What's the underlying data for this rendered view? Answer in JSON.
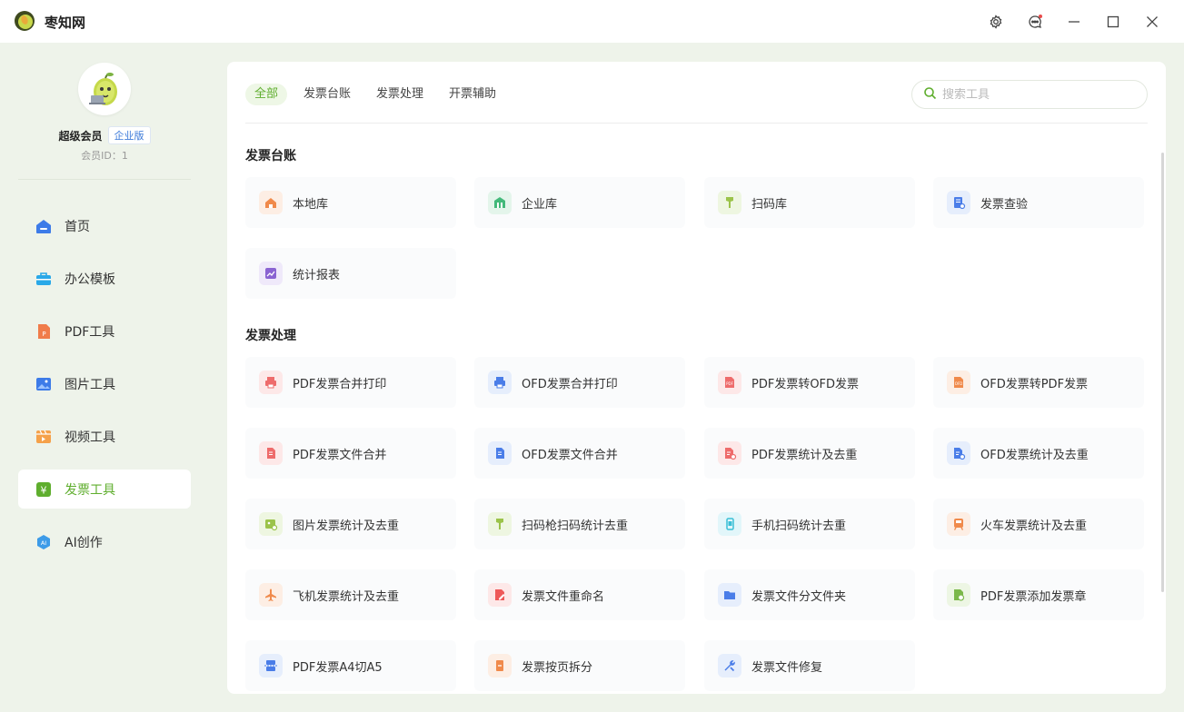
{
  "app": {
    "name": "枣知网"
  },
  "sidebar": {
    "member_title": "超级会员",
    "member_badge": "企业版",
    "member_id": "会员ID：1",
    "items": [
      {
        "label": "首页",
        "icon": "home-icon",
        "active": false
      },
      {
        "label": "办公模板",
        "icon": "briefcase-icon",
        "active": false
      },
      {
        "label": "PDF工具",
        "icon": "pdf-icon",
        "active": false
      },
      {
        "label": "图片工具",
        "icon": "image-icon",
        "active": false
      },
      {
        "label": "视频工具",
        "icon": "video-icon",
        "active": false
      },
      {
        "label": "发票工具",
        "icon": "invoice-icon",
        "active": true
      },
      {
        "label": "AI创作",
        "icon": "ai-icon",
        "active": false
      }
    ]
  },
  "tabs": [
    {
      "label": "全部",
      "active": true
    },
    {
      "label": "发票台账",
      "active": false
    },
    {
      "label": "发票处理",
      "active": false
    },
    {
      "label": "开票辅助",
      "active": false
    }
  ],
  "search": {
    "placeholder": "搜索工具"
  },
  "sections": [
    {
      "title": "发票台账",
      "tools": [
        {
          "label": "本地库",
          "icon": "home-store-icon",
          "color": "#f08a4b",
          "bg": "#fdeee4"
        },
        {
          "label": "企业库",
          "icon": "building-icon",
          "color": "#43b97a",
          "bg": "#e4f5eb"
        },
        {
          "label": "扫码库",
          "icon": "scanner-icon",
          "color": "#9bc34a",
          "bg": "#eef6e1"
        },
        {
          "label": "发票查验",
          "icon": "invoice-check-icon",
          "color": "#4a7de8",
          "bg": "#e6eefc"
        },
        {
          "label": "统计报表",
          "icon": "report-chart-icon",
          "color": "#8a63d2",
          "bg": "#efe9fa"
        }
      ]
    },
    {
      "title": "发票处理",
      "tools": [
        {
          "label": "PDF发票合并打印",
          "icon": "printer-icon",
          "color": "#ee6b6b",
          "bg": "#fde8e8"
        },
        {
          "label": "OFD发票合并打印",
          "icon": "printer-icon",
          "color": "#4a7de8",
          "bg": "#e6eefc"
        },
        {
          "label": "PDF发票转OFD发票",
          "icon": "pdf-convert-icon",
          "color": "#ee6b6b",
          "bg": "#fde8e8"
        },
        {
          "label": "OFD发票转PDF发票",
          "icon": "ofd-convert-icon",
          "color": "#f08a4b",
          "bg": "#fdeee4"
        },
        {
          "label": "PDF发票文件合并",
          "icon": "file-merge-icon",
          "color": "#ee6b6b",
          "bg": "#fde8e8"
        },
        {
          "label": "OFD发票文件合并",
          "icon": "file-merge-icon",
          "color": "#4a7de8",
          "bg": "#e6eefc"
        },
        {
          "label": "PDF发票统计及去重",
          "icon": "file-dedupe-icon",
          "color": "#ee6b6b",
          "bg": "#fde8e8"
        },
        {
          "label": "OFD发票统计及去重",
          "icon": "file-dedupe-icon",
          "color": "#4a7de8",
          "bg": "#e6eefc"
        },
        {
          "label": "图片发票统计及去重",
          "icon": "image-dedupe-icon",
          "color": "#9bc34a",
          "bg": "#eef6e1"
        },
        {
          "label": "扫码枪扫码统计去重",
          "icon": "scanner-icon",
          "color": "#9bc34a",
          "bg": "#eef6e1"
        },
        {
          "label": "手机扫码统计去重",
          "icon": "phone-icon",
          "color": "#3bbfd6",
          "bg": "#e2f6fa"
        },
        {
          "label": "火车发票统计及去重",
          "icon": "train-icon",
          "color": "#f08a4b",
          "bg": "#fdeee4"
        },
        {
          "label": "飞机发票统计及去重",
          "icon": "plane-icon",
          "color": "#f08a4b",
          "bg": "#fdeee4"
        },
        {
          "label": "发票文件重命名",
          "icon": "rename-icon",
          "color": "#ee5a5a",
          "bg": "#fde8e8"
        },
        {
          "label": "发票文件分文件夹",
          "icon": "folder-icon",
          "color": "#4a7de8",
          "bg": "#e6eefc"
        },
        {
          "label": "PDF发票添加发票章",
          "icon": "stamp-icon",
          "color": "#7bb84a",
          "bg": "#edf6e4"
        },
        {
          "label": "PDF发票A4切A5",
          "icon": "cut-page-icon",
          "color": "#4a7de8",
          "bg": "#e6eefc"
        },
        {
          "label": "发票按页拆分",
          "icon": "split-page-icon",
          "color": "#f08a4b",
          "bg": "#fdeee4"
        },
        {
          "label": "发票文件修复",
          "icon": "repair-icon",
          "color": "#4a7de8",
          "bg": "#e6eefc"
        }
      ]
    }
  ],
  "colors": {
    "accent": "#5fae2e",
    "background": "#eef3ea"
  }
}
